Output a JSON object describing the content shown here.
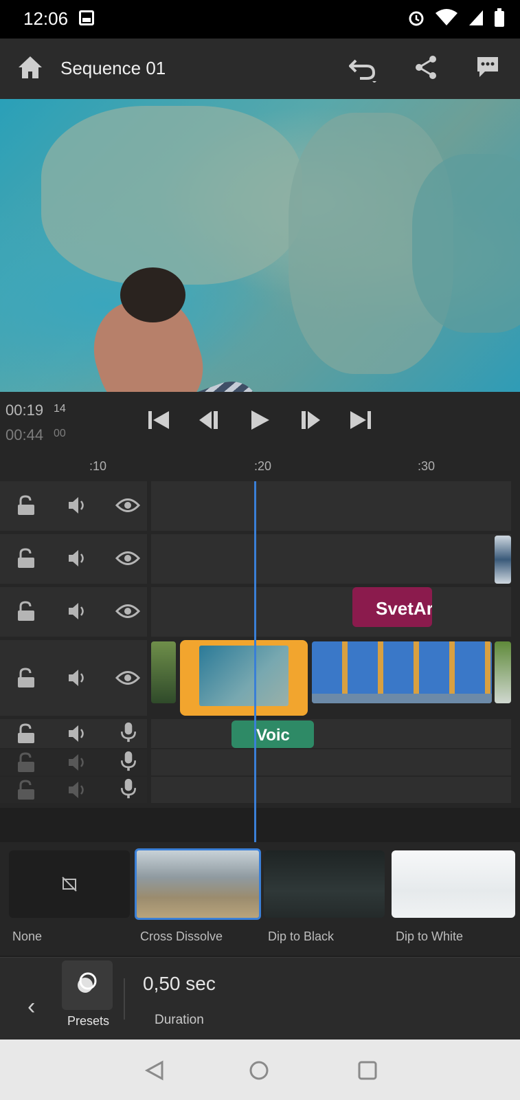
{
  "status_bar": {
    "time": "12:06"
  },
  "app_bar": {
    "title": "Sequence 01"
  },
  "timecode": {
    "current": "00:19",
    "current_frames": "14",
    "total": "00:44",
    "total_frames": "00"
  },
  "ruler": {
    "marks": [
      ":10",
      ":20",
      ":30"
    ]
  },
  "clips": {
    "title_clip_label": "SvetAr",
    "voiceover_label": "Voic"
  },
  "transitions": {
    "items": [
      {
        "label": "None"
      },
      {
        "label": "Cross Dissolve",
        "selected": true
      },
      {
        "label": "Dip to Black"
      },
      {
        "label": "Dip to White"
      }
    ]
  },
  "bottom_bar": {
    "presets_label": "Presets",
    "duration_value": "0,50 sec",
    "duration_label": "Duration"
  },
  "colors": {
    "accent": "#3a7fd6",
    "clip_selected": "#f2a52e",
    "title_clip": "#8b1b4d",
    "audio_clip": "#2e8a66"
  }
}
